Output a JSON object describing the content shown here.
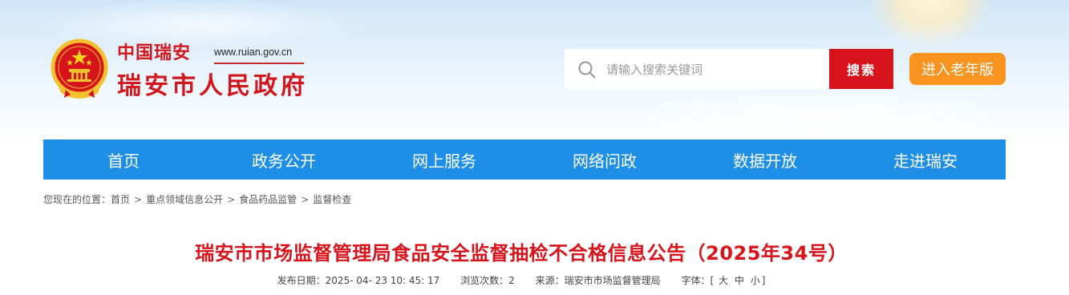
{
  "header": {
    "site_name_small": "中国瑞安",
    "site_url": "www.ruian.gov.cn",
    "site_name_main": "瑞安市人民政府",
    "emblem_icon": "national-emblem-icon"
  },
  "search": {
    "placeholder": "请输入搜索关键词",
    "button_label": "搜索",
    "icon": "search-icon"
  },
  "elder_mode": {
    "label": "进入老年版"
  },
  "nav": {
    "items": [
      {
        "label": "首页"
      },
      {
        "label": "政务公开"
      },
      {
        "label": "网上服务"
      },
      {
        "label": "网络问政"
      },
      {
        "label": "数据开放"
      },
      {
        "label": "走进瑞安"
      }
    ]
  },
  "breadcrumb": {
    "prefix": "您现在的位置：",
    "items": [
      {
        "label": "首页"
      },
      {
        "label": "重点领域信息公开"
      },
      {
        "label": "食品药品监管"
      },
      {
        "label": "监督检查"
      }
    ],
    "separator": ">"
  },
  "article": {
    "title": "瑞安市市场监督管理局食品安全监督抽检不合格信息公告（2025年34号）",
    "publish_label": "发布日期：",
    "publish_date": "2025- 04- 23 10: 45: 17",
    "views_label": "浏览次数：",
    "views": "2",
    "source_label": "来源：",
    "source": "瑞安市市场监督管理局",
    "fontsize_label": "字体：[",
    "fontsize_large": "大",
    "fontsize_medium": "中",
    "fontsize_small": "小",
    "fontsize_end": "]"
  },
  "colors": {
    "brand_red": "#d7141c",
    "nav_blue": "#1e8ee6",
    "elder_orange": "#f7931e"
  }
}
